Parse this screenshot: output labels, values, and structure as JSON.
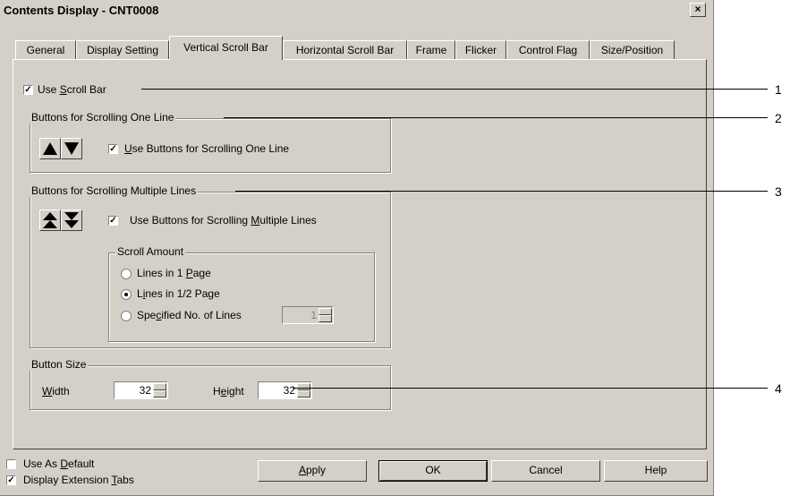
{
  "window": {
    "title": "Contents Display - CNT0008",
    "close": "×"
  },
  "tabs": [
    {
      "label": "General"
    },
    {
      "label": "Display Setting"
    },
    {
      "label": "Vertical Scroll Bar"
    },
    {
      "label": "Horizontal Scroll Bar"
    },
    {
      "label": "Frame"
    },
    {
      "label": "Flicker"
    },
    {
      "label": "Control Flag"
    },
    {
      "label": "Size/Position"
    }
  ],
  "active_tab": "Vertical Scroll Bar",
  "use_scroll_bar": {
    "pre": "Use ",
    "u": "S",
    "post": "croll Bar",
    "checked": true
  },
  "one_line": {
    "legend": "Buttons for Scrolling One Line",
    "checkbox": {
      "pre": "",
      "u": "U",
      "post": "se Buttons for Scrolling One Line",
      "checked": true
    }
  },
  "multi_line": {
    "legend": "Buttons for Scrolling Multiple Lines",
    "checkbox": {
      "pre": "Use Buttons for Scrolling ",
      "u": "M",
      "post": "ultiple Lines",
      "checked": true
    },
    "scroll_amount": {
      "legend": "Scroll Amount",
      "options": [
        {
          "pre": "Lines in 1 ",
          "u": "P",
          "post": "age",
          "selected": false
        },
        {
          "pre": "L",
          "u": "i",
          "post": "nes in 1/2 Page",
          "selected": true
        },
        {
          "pre": "Spe",
          "u": "c",
          "post": "ified No. of Lines",
          "selected": false
        }
      ],
      "lines_value": "1"
    }
  },
  "button_size": {
    "legend": "Button Size",
    "width_label": {
      "pre": "",
      "u": "W",
      "post": "idth"
    },
    "width_value": "32",
    "height_label": {
      "pre": "H",
      "u": "e",
      "post": "ight"
    },
    "height_value": "32"
  },
  "footer": {
    "use_as_default": {
      "pre": "Use As ",
      "u": "D",
      "post": "efault",
      "checked": false
    },
    "display_ext_tabs": {
      "pre": "Display Extension ",
      "u": "T",
      "post": "abs",
      "checked": true
    },
    "buttons": {
      "apply_u": "A",
      "apply_post": "pply",
      "ok": "OK",
      "cancel": "Cancel",
      "help": "Help"
    }
  },
  "callouts": [
    "1",
    "2",
    "3",
    "4"
  ]
}
